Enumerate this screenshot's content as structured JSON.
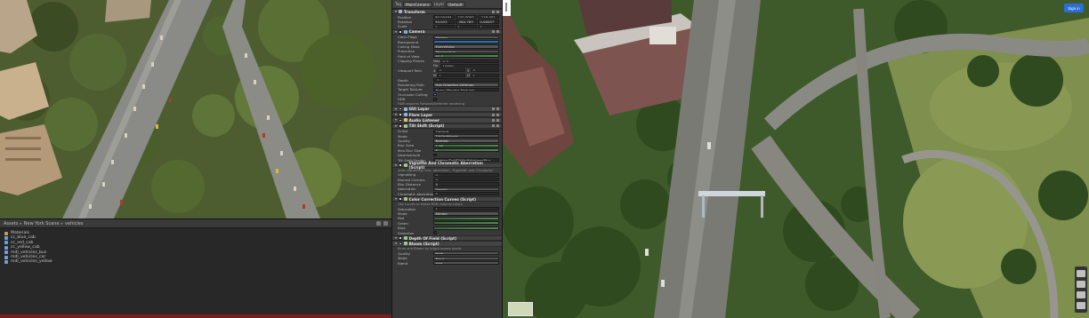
{
  "project": {
    "breadcrumb": [
      "Assets",
      "New York Scene",
      "vehicles"
    ],
    "items": [
      {
        "label": "Materials",
        "kind": "folder"
      },
      {
        "label": "cc_blue_cab",
        "kind": "asset"
      },
      {
        "label": "cc_red_cab",
        "kind": "asset"
      },
      {
        "label": "cc_yellow_cab",
        "kind": "asset"
      },
      {
        "label": "mdl_vehicles_bus",
        "kind": "asset"
      },
      {
        "label": "mdl_vehicles_car",
        "kind": "asset"
      },
      {
        "label": "mdl_vehicles_yellow",
        "kind": "asset"
      }
    ]
  },
  "inspector": {
    "tag_label": "Tag",
    "tag_value": "MainCamera",
    "layer_label": "Layer",
    "layer_value": "Default",
    "transform": {
      "title": "Transform",
      "rows": [
        {
          "name": "Position",
          "x": "90.05484",
          "y": "120.0097",
          "z": "-116.451"
        },
        {
          "name": "Rotation",
          "x": "50.053",
          "y": "-260.763",
          "z": "0.00057"
        },
        {
          "name": "Scale",
          "x": "1",
          "y": "1",
          "z": "1"
        }
      ]
    },
    "camera": {
      "title": "Camera",
      "rows": [
        {
          "name": "Clear Flags",
          "value": "Skybox"
        },
        {
          "name": "Background",
          "value": ""
        },
        {
          "name": "Culling Mask",
          "value": "Everything"
        },
        {
          "name": "Projection",
          "value": "Perspective"
        },
        {
          "name": "Field of View",
          "value": "60.0"
        }
      ],
      "clipping_label": "Clipping Planes",
      "near_label": "Near",
      "near_value": "0.3",
      "far_label": "Far",
      "far_value": "10000",
      "viewport_label": "Viewport Rect",
      "viewport": [
        {
          "k1": "X",
          "v1": "0",
          "k2": "Y",
          "v2": "0"
        },
        {
          "k1": "W",
          "v1": "1",
          "k2": "H",
          "v2": "1"
        }
      ],
      "rows2": [
        {
          "name": "Depth",
          "value": "-1"
        },
        {
          "name": "Rendering Path",
          "value": "Use Graphics Settings"
        },
        {
          "name": "Target Texture",
          "value": "None (Render Texture)"
        },
        {
          "name": "Occlusion Culling",
          "value": ""
        },
        {
          "name": "HDR",
          "value": ""
        }
      ],
      "note": "HDR requires Forward/Deferred rendering"
    },
    "components": [
      {
        "title": "GUI Layer",
        "color": "#8fb3de"
      },
      {
        "title": "Flare Layer",
        "color": "#8fb3de"
      },
      {
        "title": "Audio Listener",
        "color": "#d8c37a"
      }
    ],
    "tiltshift": {
      "title": "Tilt Shift (Script)",
      "rows": [
        {
          "name": "Script",
          "value": "TiltShift"
        },
        {
          "name": "Mode",
          "value": "TiltShiftMode"
        },
        {
          "name": "Quality",
          "value": "Normal"
        },
        {
          "name": "Blur Area",
          "value": "1.86"
        },
        {
          "name": "Max Blur Size",
          "value": "5"
        },
        {
          "name": "Downsample",
          "value": ""
        },
        {
          "name": "Tilt Shift Shader",
          "value": "Hidden/Dof/TiltShiftHdrLensBlur"
        }
      ]
    },
    "vignette": {
      "title": "Vignette And Chromatic Aberration (Script)",
      "note": "Adds vignetting, blur, aberration, 'Tognette' and 'Chromatic'",
      "rows": [
        {
          "name": "Vignetting",
          "value": "0"
        },
        {
          "name": "Blurred Corners",
          "value": "0"
        },
        {
          "name": "Blur Distance",
          "value": "0"
        },
        {
          "name": "Aberration",
          "value": "Simple"
        },
        {
          "name": "Chromatic Aberration",
          "value": "0"
        }
      ]
    },
    "colorcurves": {
      "title": "Color Correction Curves (Script)",
      "note": "Use curves to tweak RGB channel colors",
      "rows": [
        {
          "name": "Saturation",
          "value": "1"
        },
        {
          "name": "Mode",
          "value": "Simple"
        },
        {
          "name": "Red",
          "value": ""
        },
        {
          "name": "Green",
          "value": ""
        },
        {
          "name": "Blue",
          "value": ""
        },
        {
          "name": "Selective",
          "value": ""
        }
      ]
    },
    "tail_components": [
      {
        "title": "Depth Of Field (Script)",
        "color": "#8fb3de"
      },
      {
        "title": "Bloom (Script)",
        "color": "#8fb3de"
      }
    ],
    "bloom": {
      "note": "Blurs and Bloom by bright screen pixels",
      "rows": [
        {
          "name": "Quality",
          "value": "High"
        },
        {
          "name": "Mode",
          "value": "Basic"
        },
        {
          "name": "Blend",
          "value": "Add"
        }
      ]
    }
  },
  "map": {
    "signin_label": "Sign in"
  }
}
